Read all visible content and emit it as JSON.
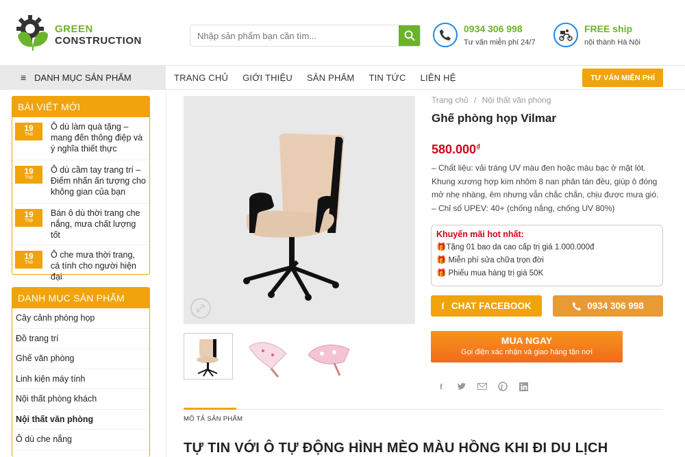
{
  "brand": {
    "line1": "GREEN",
    "line2": "CONSTRUCTION"
  },
  "search": {
    "placeholder": "Nhập sản phẩm bạn cần tìm..."
  },
  "contact": {
    "phone": {
      "title": "0934 306 998",
      "sub": "Tư vấn miễn phí 24/7",
      "icon": "phone-icon",
      "color": "#1e88e5"
    },
    "ship": {
      "title": "FREE ship",
      "sub": "nội thành Hà Nội",
      "icon": "delivery-icon"
    }
  },
  "nav": {
    "category_label": "DANH MỤC SẢN PHẨM",
    "items": [
      "TRANG CHỦ",
      "GIỚI THIỆU",
      "SẢN PHẨM",
      "TIN TỨC",
      "LIÊN HỆ"
    ],
    "consult_button": "TƯ VẤN MIỄN PHÍ"
  },
  "sidebar": {
    "posts_title": "BÀI VIẾT MỚI",
    "posts": [
      {
        "day": "19",
        "month": "Th8",
        "title": "Ô dù làm quà tặng – mang đến thông điệp và ý nghĩa thiết thực"
      },
      {
        "day": "19",
        "month": "Th8",
        "title": "Ô dù cầm tay trang trí – Điểm nhấn ấn tượng cho không gian của bạn"
      },
      {
        "day": "19",
        "month": "Th8",
        "title": "Bán ô dù thời trang che nắng, mưa chất lượng tốt"
      },
      {
        "day": "19",
        "month": "Th8",
        "title": "Ô che mưa thời trang, cá tính cho người hiện đại"
      }
    ],
    "categories_title": "DANH MỤC SẢN PHẨM",
    "categories": [
      "Cây cảnh phòng họp",
      "Đồ trang trí",
      "Ghế văn phòng",
      "Linh kiện máy tính",
      "Nội thất phòng khách",
      "Nội thất văn phòng",
      "Ô dù che nắng"
    ],
    "active_category": "Nội thất văn phòng"
  },
  "product": {
    "breadcrumb": {
      "home": "Trang chủ",
      "sep": "/",
      "current": "Nội thất văn phòng"
    },
    "title": "Ghế phòng họp Vilmar",
    "price": "580.000",
    "currency": "₫",
    "description": "– Chất liệu: vải tráng UV màu đen hoặc màu bạc ở mặt lót. Khung xương hợp kim nhôm 8 nan phân tán đều, giúp ô đóng mở nhẹ nhàng, êm nhưng vẫn chắc chắn, chịu được mưa gió.",
    "description2": "– Chỉ số UPEV: 40+ (chống nắng, chống UV 80%)",
    "promo": {
      "title": "Khuyến mãi hot nhất:",
      "items": [
        "Tặng 01 bao da cao cấp trị giá 1.000.000đ",
        "Miễn phí sửa chữa trọn đời",
        "Phiếu mua hàng trị giá 50K"
      ],
      "icon": "gift-icon"
    },
    "chat_button": "CHAT FACEBOOK",
    "phone_button": "0934 306 998",
    "buy": {
      "title": "MUA NGAY",
      "sub": "Gọi điện xác nhận và giao hàng tận nơi"
    },
    "tab_label": "MÔ TẢ SẢN PHẨM",
    "article_title": "TỰ TIN VỚI Ô TỰ ĐỘNG HÌNH MÈO MÀU HỒNG KHI ĐI DU LỊCH"
  },
  "colors": {
    "green": "#6bb32b",
    "orange": "#f0a30a",
    "red": "#d0021b",
    "buy": "#f7941d"
  }
}
